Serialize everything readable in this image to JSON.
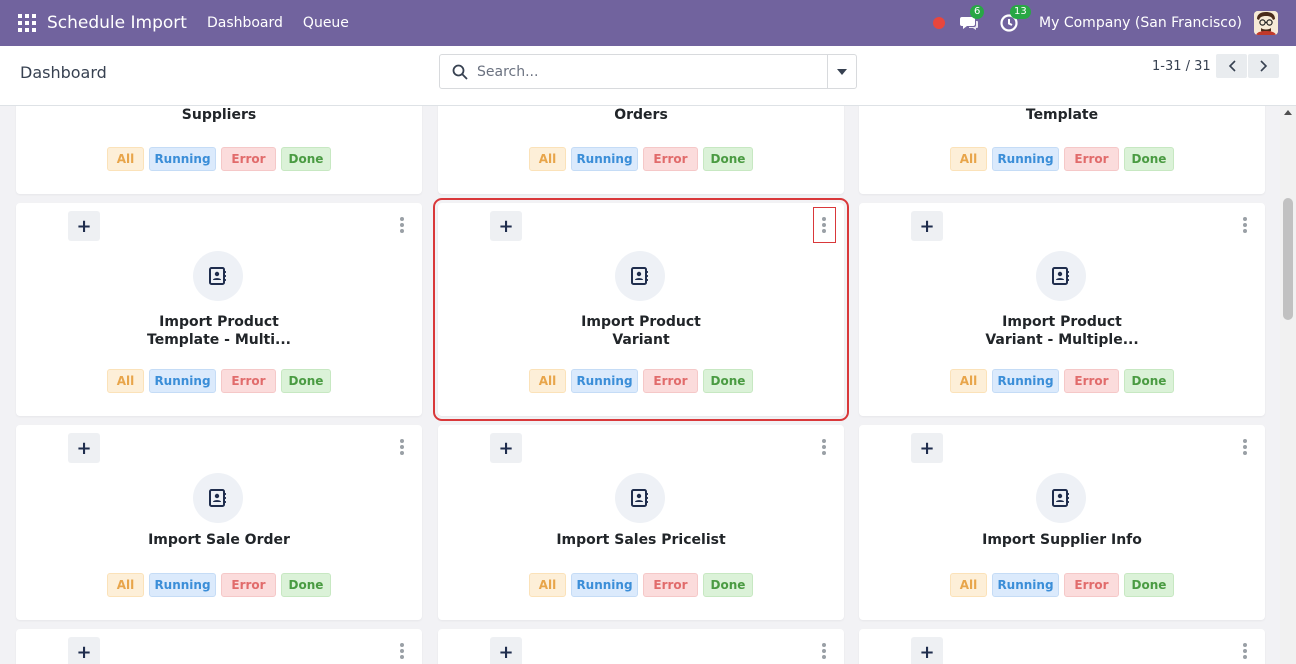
{
  "navbar": {
    "app_name": "Schedule Import",
    "menu": [
      "Dashboard",
      "Queue"
    ],
    "messages_count": "6",
    "activities_count": "13",
    "company": "My Company (San Francisco)",
    "color": "#71639e"
  },
  "control_panel": {
    "breadcrumb": "Dashboard",
    "search_placeholder": "Search...",
    "pager": "1-31 / 31"
  },
  "status_labels": {
    "all": "All",
    "running": "Running",
    "error": "Error",
    "done": "Done"
  },
  "cards": [
    {
      "title_lines": [
        "Suppliers"
      ],
      "partial": true
    },
    {
      "title_lines": [
        "Orders"
      ],
      "partial": true
    },
    {
      "title_lines": [
        "Template"
      ],
      "partial": true
    },
    {
      "title_lines": [
        "Import Product",
        "Template - Multi..."
      ]
    },
    {
      "title_lines": [
        "Import Product",
        "Variant"
      ],
      "highlighted": true
    },
    {
      "title_lines": [
        "Import Product",
        "Variant - Multiple..."
      ]
    },
    {
      "title_lines": [
        "Import Sale Order"
      ]
    },
    {
      "title_lines": [
        "Import Sales Pricelist"
      ]
    },
    {
      "title_lines": [
        "Import Supplier Info"
      ]
    }
  ],
  "highlight_color": "#d9383a"
}
